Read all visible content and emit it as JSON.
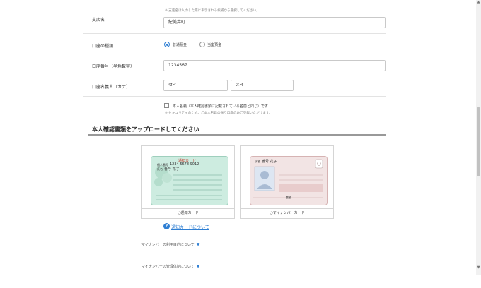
{
  "form": {
    "branch_name": {
      "hint": "※ 支店名は入力した際に表示される候補から選択してください。",
      "label": "支店名",
      "value": "紀美井町"
    },
    "account_type": {
      "label": "口座の種類",
      "options": [
        "普通預金",
        "当座預金"
      ],
      "selected": "普通預金"
    },
    "account_number": {
      "label": "口座番号（半角数字）",
      "value": "1234567"
    },
    "account_holder": {
      "label": "口座名義人（カナ）",
      "last_name": "セイ",
      "first_name": "メイ"
    },
    "same_name": {
      "checkbox_label": "本人名義（本人確認書類に記載されている名前と同じ）です",
      "note": "※ セキュリティのため、ご本人名義の振り口座のみご登録いただけます。"
    }
  },
  "upload": {
    "title": "本人確認書類をアップロードしてください",
    "cards": [
      {
        "caption": "○通知カード",
        "card_title": "通知カード",
        "number": "1234 5678 9012",
        "name_label": "氏名",
        "name": "番号 花子"
      },
      {
        "caption": "○マイナンバーカード",
        "name_label": "氏名",
        "name": "番号 花子",
        "sign": "署名"
      }
    ],
    "help_link": "通知カードについて",
    "toggles": [
      "マイナンバーの利用目的について",
      "マイナンバーの管理体制について"
    ]
  },
  "icons": {
    "help": "question-circle-icon",
    "toggle": "triangle-down-icon"
  },
  "colors": {
    "accent": "#2f7fd3",
    "notice_card": "#cdece0",
    "mynumber_card": "#f2d9d9"
  }
}
